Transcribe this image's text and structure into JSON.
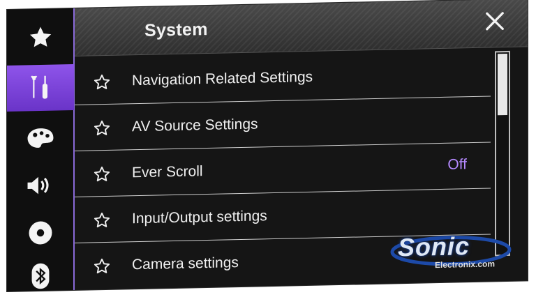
{
  "header": {
    "title": "System"
  },
  "sidebar": {
    "items": [
      {
        "icon": "star-icon"
      },
      {
        "icon": "tools-icon",
        "active": true
      },
      {
        "icon": "palette-icon"
      },
      {
        "icon": "speaker-icon"
      },
      {
        "icon": "disc-icon"
      },
      {
        "icon": "bluetooth-icon"
      }
    ]
  },
  "list": {
    "items": [
      {
        "label": "Navigation Related Settings",
        "value": ""
      },
      {
        "label": "AV Source Settings",
        "value": ""
      },
      {
        "label": "Ever Scroll",
        "value": "Off"
      },
      {
        "label": "Input/Output settings",
        "value": ""
      },
      {
        "label": "Camera settings",
        "value": ""
      }
    ]
  },
  "watermark": {
    "brand": "Sonic",
    "sub": "Electronix.com"
  },
  "colors": {
    "accent": "#8e54ea",
    "value_text": "#b58aff",
    "background": "#151515"
  }
}
